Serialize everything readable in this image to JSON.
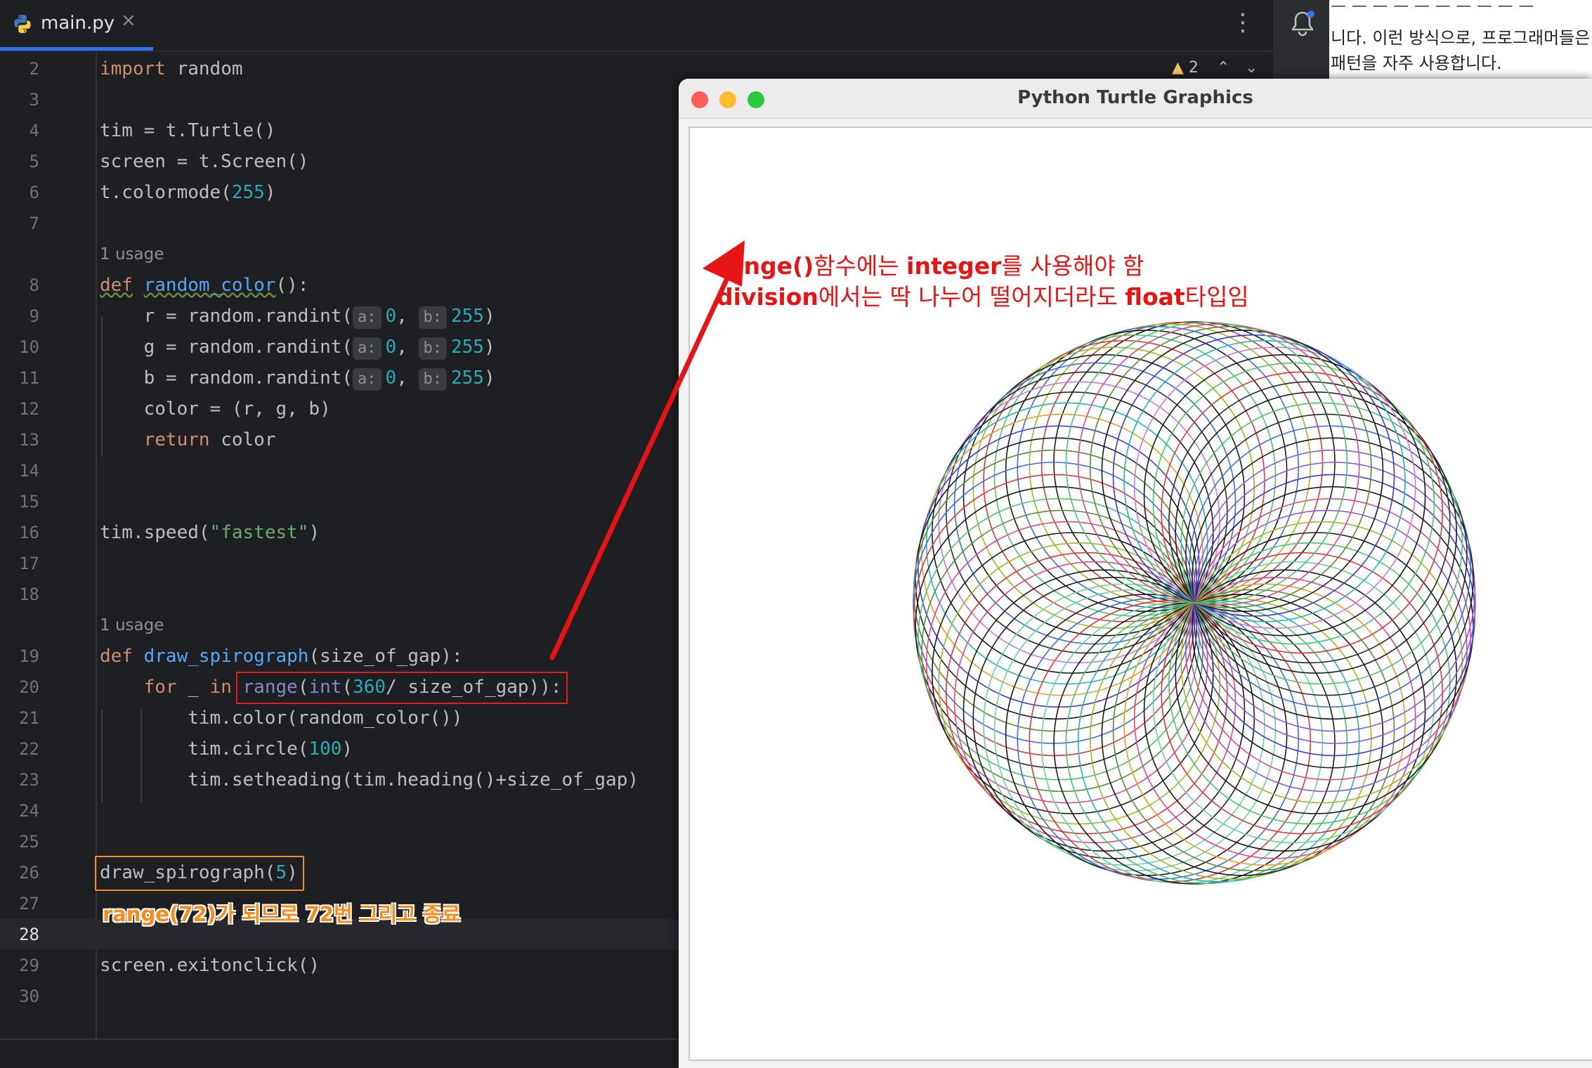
{
  "tab": {
    "filename": "main.py",
    "close": "×"
  },
  "inspections": {
    "warnings": "2"
  },
  "lines": [
    {
      "n": "2"
    },
    {
      "n": "3"
    },
    {
      "n": "4"
    },
    {
      "n": "5"
    },
    {
      "n": "6"
    },
    {
      "n": "7"
    },
    {
      "n": "8"
    },
    {
      "n": "9"
    },
    {
      "n": "10"
    },
    {
      "n": "11"
    },
    {
      "n": "12"
    },
    {
      "n": "13"
    },
    {
      "n": "14"
    },
    {
      "n": "15"
    },
    {
      "n": "16"
    },
    {
      "n": "17"
    },
    {
      "n": "18"
    },
    {
      "n": "19"
    },
    {
      "n": "20"
    },
    {
      "n": "21"
    },
    {
      "n": "22"
    },
    {
      "n": "23"
    },
    {
      "n": "24"
    },
    {
      "n": "25"
    },
    {
      "n": "26"
    },
    {
      "n": "27"
    },
    {
      "n": "28"
    },
    {
      "n": "29"
    },
    {
      "n": "30"
    }
  ],
  "code": {
    "l2": [
      "import",
      " random"
    ],
    "l4": "tim = t.Turtle()",
    "l5": "screen = t.Screen()",
    "l6": [
      "t.colormode(",
      "255",
      ")"
    ],
    "usage": "1 usage",
    "l8": [
      "def",
      " ",
      "random_color",
      "():"
    ],
    "rand_prefix_r": "    r = random.randint(",
    "rand_prefix_g": "    g = random.randint(",
    "rand_prefix_b": "    b = random.randint(",
    "hint_a": "a:",
    "hint_b": "b:",
    "zero": "0",
    "comma": ", ",
    "max": "255",
    "close": ")",
    "l12": "    color = (r, g, b)",
    "l13": [
      "    ",
      "return",
      " color"
    ],
    "l16": [
      "tim.speed(",
      "\"fastest\"",
      ")"
    ],
    "l19": [
      "def",
      " ",
      "draw_spirograph",
      "(size_of_gap):"
    ],
    "l20": [
      "    ",
      "for",
      " _ ",
      "in",
      " ",
      "range",
      "(",
      "int",
      "(",
      "360",
      "/ size_of_gap)):"
    ],
    "l21": "        tim.color(random_color())",
    "l22": [
      "        tim.circle(",
      "100",
      ")"
    ],
    "l23": "        tim.setheading(tim.heading()+size_of_gap)",
    "l26": [
      "draw_spirograph(",
      "5",
      ")"
    ],
    "l29": "screen.exitonclick()"
  },
  "annotations": {
    "ide_note": "range(72)가 되므로 72번 그리고 종료",
    "turtle_note1_bold": "range()",
    "turtle_note1_a": "함수에는 ",
    "turtle_note1_bold2": "integer",
    "turtle_note1_b": "를 사용해야 함",
    "turtle_note2_bold": "division",
    "turtle_note2_a": "에서는 딱 나누어 떨어지더라도 ",
    "turtle_note2_bold2": "float",
    "turtle_note2_b": "타입임"
  },
  "doc_strip": {
    "line1": "니다. 이런 방식으로, 프로그래머들은",
    "line2": "패턴을 자주 사용합니다."
  },
  "turtle_window": {
    "title": "Python Turtle Graphics",
    "circle_count": 72,
    "gap_degrees": 5,
    "radius_units": 100
  },
  "colors": {
    "traffic_close": "#ff5f57",
    "traffic_min": "#febc2e",
    "traffic_max": "#28c840",
    "annotation_red": "#e61414",
    "annotation_orange": "#ff8a1a"
  }
}
